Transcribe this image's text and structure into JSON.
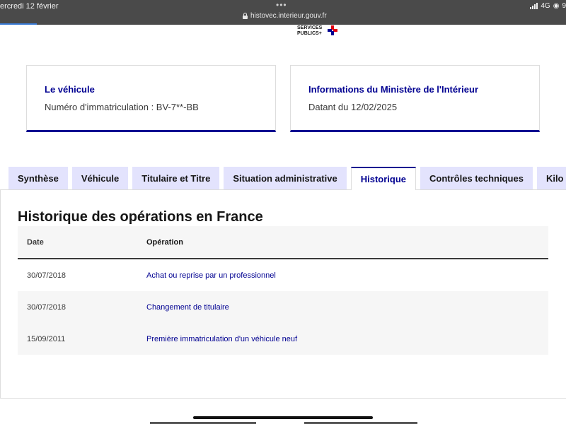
{
  "statusbar": {
    "time": "ercredi 12 février",
    "dots": "•••",
    "url": "histovec.interieur.gouv.fr",
    "network": "4G",
    "battery_fragment": "9"
  },
  "logo": {
    "line1": "SERVICES",
    "line2": "PUBLICS+"
  },
  "cards": [
    {
      "title": "Le véhicule",
      "value": "Numéro d'immatriculation : BV-7**-BB"
    },
    {
      "title": "Informations du Ministère de l'Intérieur",
      "value": "Datant du 12/02/2025"
    }
  ],
  "tabs": [
    {
      "label": "Synthèse",
      "active": false
    },
    {
      "label": "Véhicule",
      "active": false
    },
    {
      "label": "Titulaire et Titre",
      "active": false
    },
    {
      "label": "Situation administrative",
      "active": false
    },
    {
      "label": "Historique",
      "active": true
    },
    {
      "label": "Contrôles techniques",
      "active": false
    },
    {
      "label": "Kilo",
      "active": false
    }
  ],
  "section_title": "Historique des opérations en France",
  "table": {
    "headers": [
      "Date",
      "Opération"
    ],
    "rows": [
      [
        "30/07/2018",
        "Achat ou reprise par un professionnel"
      ],
      [
        "30/07/2018",
        "Changement de titulaire"
      ],
      [
        "15/09/2011",
        "Première immatriculation d'un véhicule neuf"
      ]
    ]
  },
  "colors": {
    "accent": "#000091",
    "tab_bg": "#e3e3fd",
    "row_alt": "#f6f6f6",
    "statusbar": "#4a4a4a"
  }
}
